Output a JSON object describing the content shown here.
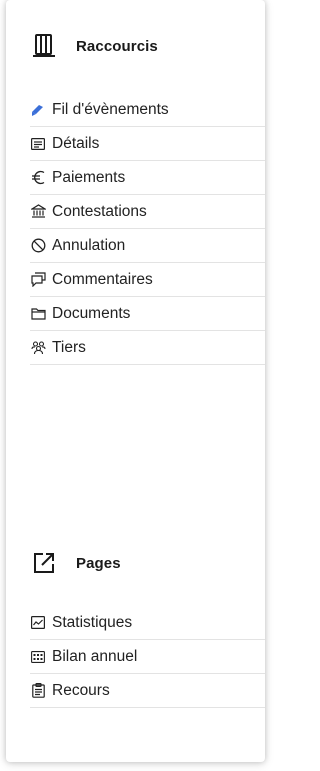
{
  "colors": {
    "accent": "#3b6fd8",
    "text": "#222222",
    "divider": "#e3e3e3"
  },
  "shortcuts": {
    "title": "Raccourcis",
    "icon": "ledger-book-icon",
    "items": [
      {
        "label": "Fil d'évènements",
        "icon": "pencil-icon"
      },
      {
        "label": "Détails",
        "icon": "details-card-icon"
      },
      {
        "label": "Paiements",
        "icon": "euro-icon"
      },
      {
        "label": "Contestations",
        "icon": "courthouse-icon"
      },
      {
        "label": "Annulation",
        "icon": "cancel-icon"
      },
      {
        "label": "Commentaires",
        "icon": "comments-icon"
      },
      {
        "label": "Documents",
        "icon": "folder-icon"
      },
      {
        "label": "Tiers",
        "icon": "people-icon"
      }
    ]
  },
  "pages": {
    "title": "Pages",
    "icon": "external-link-icon",
    "items": [
      {
        "label": "Statistiques",
        "icon": "chart-icon"
      },
      {
        "label": "Bilan annuel",
        "icon": "calculator-icon"
      },
      {
        "label": "Recours",
        "icon": "clipboard-icon"
      }
    ]
  }
}
